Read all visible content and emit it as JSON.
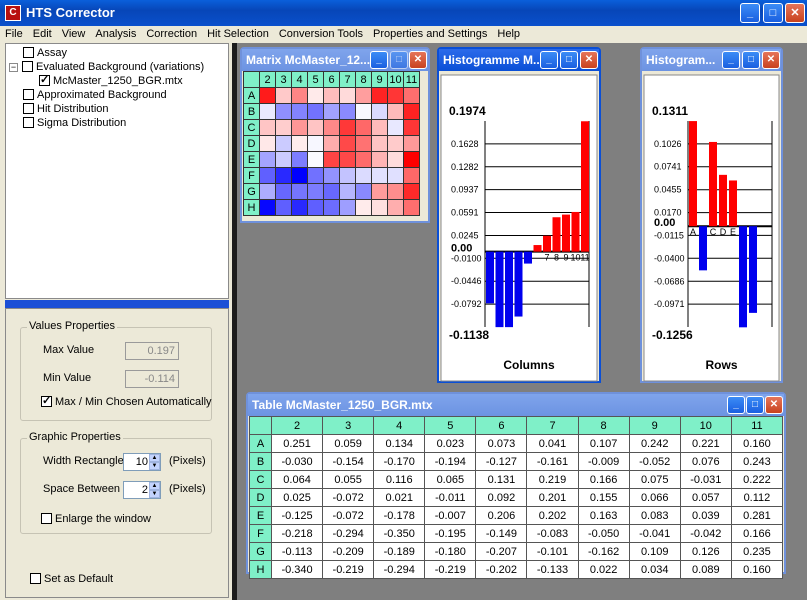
{
  "window": {
    "title": "HTS Corrector",
    "icon_letter": "C",
    "min_glyph": "_",
    "max_glyph": "□",
    "close_glyph": "✕"
  },
  "menu": [
    "File",
    "Edit",
    "View",
    "Analysis",
    "Correction",
    "Hit Selection",
    "Conversion Tools",
    "Properties and Settings",
    "Help"
  ],
  "tree": {
    "items": [
      {
        "label": "Assay",
        "checked": false,
        "level": 1
      },
      {
        "label": "Evaluated Background (variations)",
        "checked": false,
        "level": 0,
        "expander": "−"
      },
      {
        "label": "McMaster_1250_BGR.mtx",
        "checked": true,
        "level": 2
      },
      {
        "label": "Approximated Background",
        "checked": false,
        "level": 1
      },
      {
        "label": "Hit Distribution",
        "checked": false,
        "level": 1
      },
      {
        "label": "Sigma Distribution",
        "checked": false,
        "level": 1
      }
    ]
  },
  "values_properties": {
    "title": "Values Properties",
    "max_label": "Max Value",
    "max_value": "0.197",
    "min_label": "Min Value",
    "min_value": "-0.114",
    "auto_label": "Max / Min Chosen Automatically",
    "auto_checked": true
  },
  "graphic_properties": {
    "title": "Graphic Properties",
    "width_label": "Width Rectangles",
    "width_value": "10",
    "width_unit": "(Pixels)",
    "space_label": "Space Between",
    "space_value": "2",
    "space_unit": "(Pixels)",
    "enlarge_label": "Enlarge the window",
    "enlarge_checked": false
  },
  "set_default": {
    "label": "Set as Default",
    "checked": false
  },
  "matrix_window": {
    "title": "Matrix McMaster_12...",
    "col_headers": [
      "2",
      "3",
      "4",
      "5",
      "6",
      "7",
      "8",
      "9",
      "10",
      "11"
    ],
    "row_headers": [
      "A",
      "B",
      "C",
      "D",
      "E",
      "F",
      "G",
      "H"
    ],
    "min": -0.35,
    "max": 0.281
  },
  "hist_columns": {
    "title": "Histogramme M...",
    "top_label": "0.1974",
    "bottom_label": "-0.1138",
    "zero_label": "0.00",
    "caption": "Columns",
    "ticks_pos": [
      "0.1628",
      "0.1282",
      "0.0937",
      "0.0591",
      "0.0245"
    ],
    "ticks_neg": [
      "-0.0100",
      "-0.0446",
      "-0.0792"
    ],
    "tick_values": [
      0.1628,
      0.1282,
      0.0937,
      0.0591,
      0.0245,
      -0.01,
      -0.0446,
      -0.0792
    ],
    "bar_labels": [
      "7",
      "8",
      "9",
      "10",
      "11"
    ],
    "values": [
      -0.078,
      -0.114,
      -0.114,
      -0.098,
      -0.018,
      0.01,
      0.024,
      0.052,
      0.056,
      0.06,
      0.197
    ],
    "positive_color": "#FF0000",
    "negative_color": "#0000EE"
  },
  "hist_rows": {
    "title": "Histogram...",
    "top_label": "0.1311",
    "bottom_label": "-0.1256",
    "zero_label": "0.00",
    "caption": "Rows",
    "ticks_pos": [
      "0.1026",
      "0.0741",
      "0.0455",
      "0.0170"
    ],
    "ticks_neg": [
      "-0.0115",
      "-0.0400",
      "-0.0686",
      "-0.0971"
    ],
    "tick_values": [
      0.1026,
      0.0741,
      0.0455,
      0.017,
      -0.0115,
      -0.04,
      -0.0686,
      -0.0971
    ],
    "bar_labels": [
      "A",
      "C",
      "D",
      "E"
    ],
    "values": [
      0.131,
      -0.055,
      0.105,
      0.064,
      0.057,
      -0.126,
      -0.108,
      0.0
    ]
  },
  "table_window": {
    "title": "Table McMaster_1250_BGR.mtx",
    "col_headers": [
      "2",
      "3",
      "4",
      "5",
      "6",
      "7",
      "8",
      "9",
      "10",
      "11"
    ],
    "rows": [
      {
        "label": "A",
        "cells": [
          "0.251",
          "0.059",
          "0.134",
          "0.023",
          "0.073",
          "0.041",
          "0.107",
          "0.242",
          "0.221",
          "0.160"
        ]
      },
      {
        "label": "B",
        "cells": [
          "-0.030",
          "-0.154",
          "-0.170",
          "-0.194",
          "-0.127",
          "-0.161",
          "-0.009",
          "-0.052",
          "0.076",
          "0.243"
        ]
      },
      {
        "label": "C",
        "cells": [
          "0.064",
          "0.055",
          "0.116",
          "0.065",
          "0.131",
          "0.219",
          "0.166",
          "0.075",
          "-0.031",
          "0.222"
        ]
      },
      {
        "label": "D",
        "cells": [
          "0.025",
          "-0.072",
          "0.021",
          "-0.011",
          "0.092",
          "0.201",
          "0.155",
          "0.066",
          "0.057",
          "0.112"
        ]
      },
      {
        "label": "E",
        "cells": [
          "-0.125",
          "-0.072",
          "-0.178",
          "-0.007",
          "0.206",
          "0.202",
          "0.163",
          "0.083",
          "0.039",
          "0.281"
        ]
      },
      {
        "label": "F",
        "cells": [
          "-0.218",
          "-0.294",
          "-0.350",
          "-0.195",
          "-0.149",
          "-0.083",
          "-0.050",
          "-0.041",
          "-0.042",
          "0.166"
        ]
      },
      {
        "label": "G",
        "cells": [
          "-0.113",
          "-0.209",
          "-0.189",
          "-0.180",
          "-0.207",
          "-0.101",
          "-0.162",
          "0.109",
          "0.126",
          "0.235"
        ]
      },
      {
        "label": "H",
        "cells": [
          "-0.340",
          "-0.219",
          "-0.294",
          "-0.219",
          "-0.202",
          "-0.133",
          "0.022",
          "0.034",
          "0.089",
          "0.160"
        ]
      }
    ]
  }
}
